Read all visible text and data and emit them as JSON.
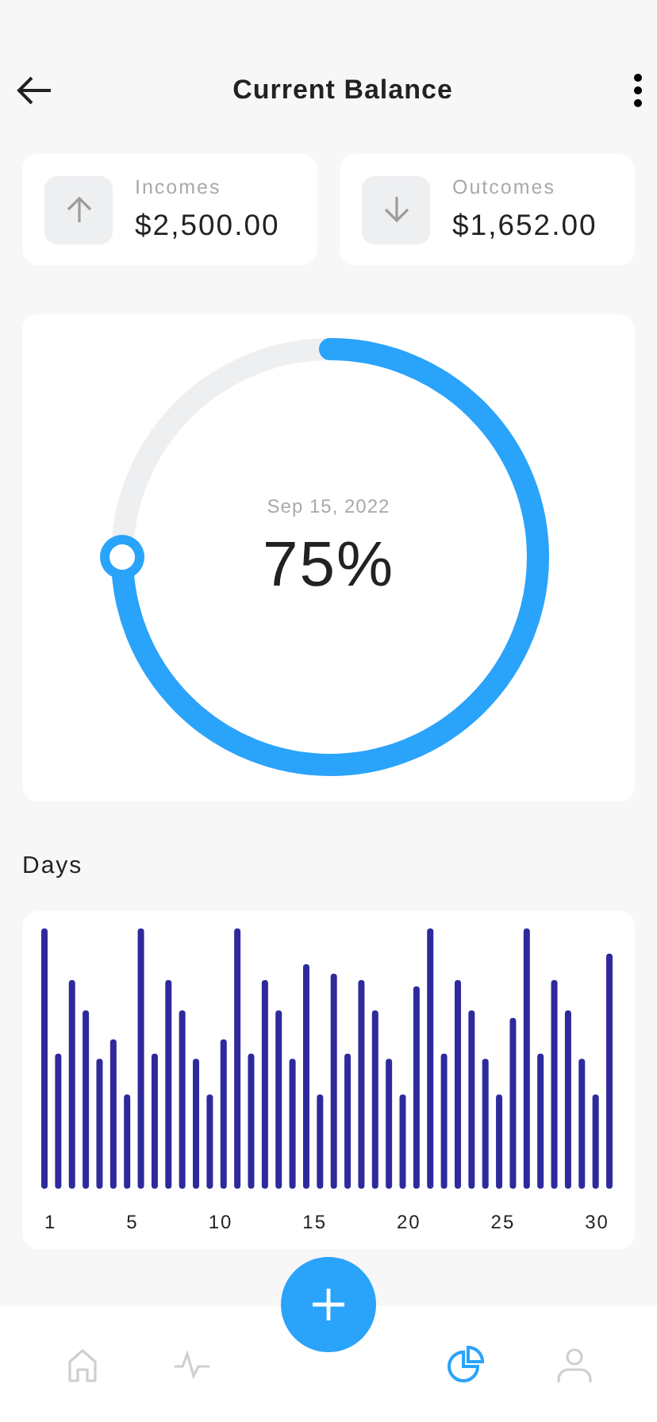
{
  "header": {
    "title": "Current Balance"
  },
  "summary": [
    {
      "kind": "income",
      "label": "Incomes",
      "amount": "$2,500.00"
    },
    {
      "kind": "outcome",
      "label": "Outcomes",
      "amount": "$1,652.00"
    }
  ],
  "progress": {
    "date": "Sep 15, 2022",
    "percent": "75%",
    "level": 0.75
  },
  "days": {
    "title": "Days",
    "axis_labels": [
      "1",
      "5",
      "10",
      "15",
      "20",
      "25",
      "30"
    ]
  },
  "nav": [
    {
      "kind": "home",
      "selected": false
    },
    {
      "kind": "activity",
      "selected": false
    },
    {
      "kind": "stats",
      "selected": true
    },
    {
      "kind": "profile",
      "selected": false
    }
  ]
}
